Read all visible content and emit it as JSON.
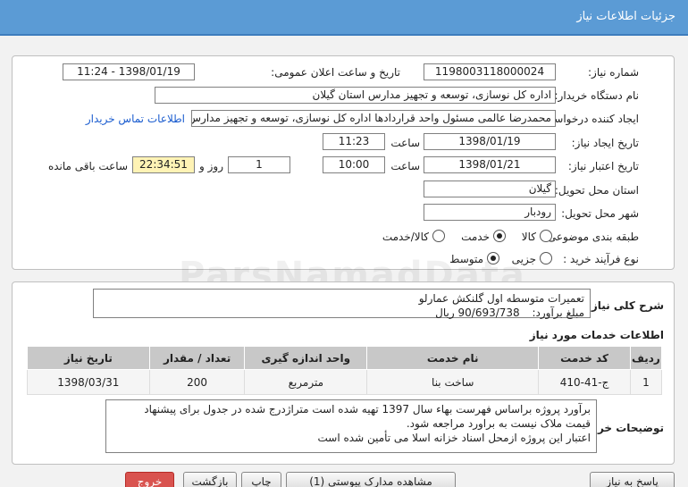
{
  "window": {
    "title": "جزئیات اطلاعات نیاز"
  },
  "form": {
    "need_number_label": "شماره نیاز:",
    "need_number": "1198003118000024",
    "announce_label": "تاریخ و ساعت اعلان عمومی:",
    "announce_value": "1398/01/19 - 11:24",
    "buyer_label": "نام دستگاه خریدار:",
    "buyer": "اداره کل نوسازی، توسعه و تجهیز مدارس استان گیلان",
    "requester_label": "ایجاد کننده درخواست:",
    "requester": "محمدرضا عالمی مسئول واحد قراردادها اداره کل نوسازی، توسعه و تجهیز مدارس",
    "contact_link": "اطلاعات تماس خریدار",
    "created_label": "تاریخ ایجاد نیاز:",
    "created_date": "1398/01/19",
    "time_label": "ساعت",
    "created_time": "11:23",
    "validity_label": "تاریخ اعتبار نیاز:",
    "validity_date": "1398/01/21",
    "validity_time": "10:00",
    "days_value": "1",
    "days_label": "روز و",
    "remaining_time": "22:34:51",
    "remaining_label": "ساعت باقی مانده",
    "province_label": "استان محل تحویل:",
    "province": "گیلان",
    "city_label": "شهر محل تحویل:",
    "city": "رودبار",
    "category_label": "طبقه بندی موضوعی:",
    "category_options": [
      "کالا",
      "خدمت",
      "کالا/خدمت"
    ],
    "category_selected": "خدمت",
    "process_label": "نوع فرآیند خرید :",
    "process_options": [
      "جزیی",
      "متوسط"
    ],
    "process_selected": "متوسط"
  },
  "summary": {
    "label": "شرح کلی نیاز:",
    "line1": "تعمیرات متوسطه اول گلنکش عمارلو",
    "line2_prefix": "مبلغ برآورد:",
    "amount": "90/693/738",
    "currency": "ریال"
  },
  "services": {
    "heading": "اطلاعات خدمات مورد نیاز",
    "columns": [
      "ردیف",
      "کد خدمت",
      "نام خدمت",
      "واحد اندازه گیری",
      "تعداد / مقدار",
      "تاریخ نیاز"
    ],
    "rows": [
      [
        "1",
        "ج-41-410",
        "ساخت بنا",
        "مترمربع",
        "200",
        "1398/03/31"
      ]
    ]
  },
  "notes": {
    "label": "توضیحات خریدار:",
    "line1": "برآورد پروژه براساس فهرست بهاء سال 1397 تهیه شده است متراژدرج شده در جدول برای پیشنهاد",
    "line2": "قیمت ملاک نیست به براورد مراجعه شود.",
    "line3": "اعتبار این پروژه ازمحل اسناد خزانه اسلا می تأمین شده است"
  },
  "buttons": {
    "reply": "پاسخ به نیاز",
    "view_docs": "مشاهده مدارک پیوستی (1)",
    "print": "چاپ",
    "back": "بازگشت",
    "exit": "خروج"
  },
  "watermark": "ParsNamadData"
}
